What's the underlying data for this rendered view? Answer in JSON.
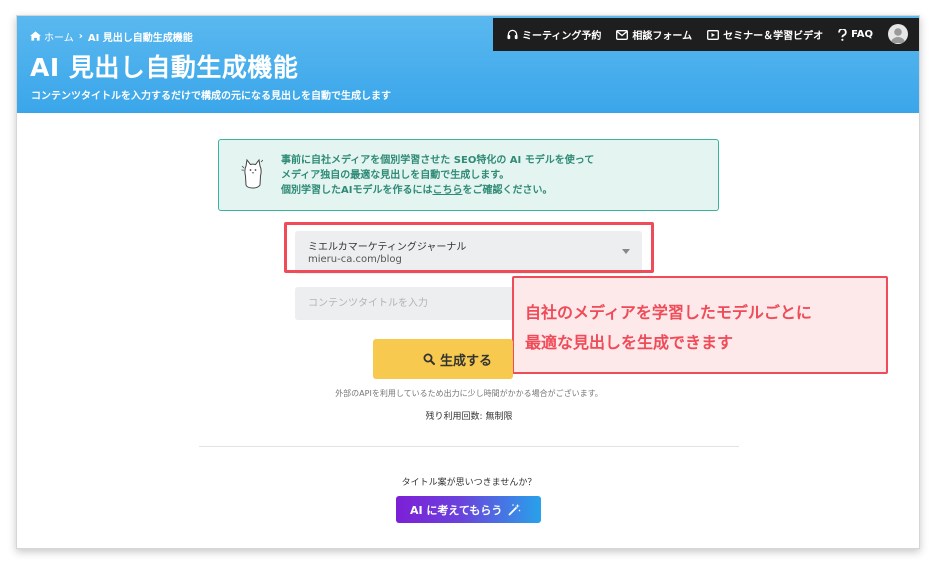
{
  "breadcrumb": {
    "home": "ホーム",
    "current": "AI 見出し自動生成機能"
  },
  "page": {
    "title": "AI 見出し自動生成機能",
    "subtitle": "コンテンツタイトルを入力するだけで構成の元になる見出しを自動で生成します"
  },
  "nav": {
    "items": [
      {
        "label": "ミーティング予約",
        "icon": "headset-icon"
      },
      {
        "label": "相談フォーム",
        "icon": "mail-icon"
      },
      {
        "label": "セミナー＆学習ビデオ",
        "icon": "video-icon"
      },
      {
        "label": "FAQ",
        "icon": "question-icon"
      }
    ],
    "avatar_icon": "user-avatar-icon"
  },
  "info": {
    "line1": "事前に自社メディアを個別学習させた SEO特化の AI モデルを使って",
    "line2": "メディア独自の最適な見出しを自動で生成します。",
    "line3_prefix": "個別学習したAIモデルを作るには",
    "line3_link": "こちら",
    "line3_suffix": "をご確認ください。",
    "mascot_icon": "cat-mascot-icon"
  },
  "media_select": {
    "name": "ミエルカマーケティングジャーナル",
    "url": "mieru-ca.com/blog"
  },
  "title_input": {
    "value": "",
    "placeholder": "コンテンツタイトルを入力"
  },
  "callout": {
    "line1": "自社のメディアを学習したモデルごとに",
    "line2": "最適な見出しを生成できます"
  },
  "generate": {
    "label": "生成する",
    "icon": "search-icon"
  },
  "note": "外部のAPIを利用しているため出力に少し時間がかかる場合がございます。",
  "remaining": "残り利用回数: 無制限",
  "ask": "タイトル案が思いつきませんか？",
  "ai_button": {
    "label": "AI に考えてもらう",
    "icon": "magic-wand-icon"
  },
  "colors": {
    "header": "#3aa6ea",
    "nav": "#1e1e1e",
    "info_border": "#39b39a",
    "highlight": "#ef4b58",
    "generate": "#f7c94e"
  }
}
